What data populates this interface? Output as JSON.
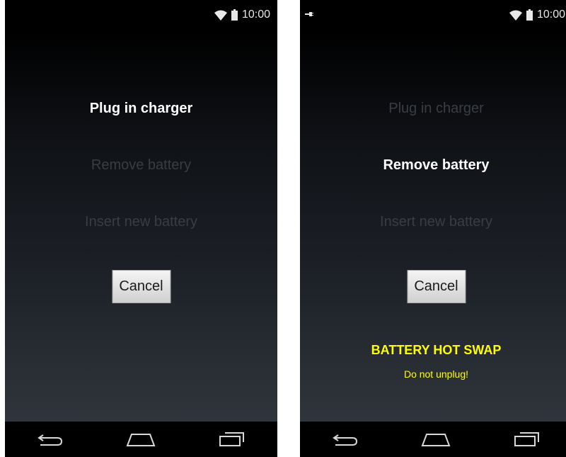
{
  "status_bar": {
    "time": "10:00"
  },
  "steps": [
    "Plug in charger",
    "Remove battery",
    "Insert new battery"
  ],
  "cancel_label": "Cancel",
  "warning": {
    "title": "BATTERY HOT SWAP",
    "subtitle": "Do not unplug!"
  },
  "screens": [
    {
      "active_step": 1,
      "charging": false,
      "show_warning": false
    },
    {
      "active_step": 2,
      "charging": true,
      "show_warning": true
    }
  ],
  "colors": {
    "active_text": "#ffffff",
    "inactive_text": "#3a3d42",
    "warning_text": "#ffff00",
    "status_icons": "#e8e8e8"
  },
  "icons": {
    "wifi": "wifi-icon",
    "battery": "battery-icon",
    "charging": "charging-plug-icon",
    "back": "back-icon",
    "home": "home-icon",
    "recents": "recents-icon"
  }
}
